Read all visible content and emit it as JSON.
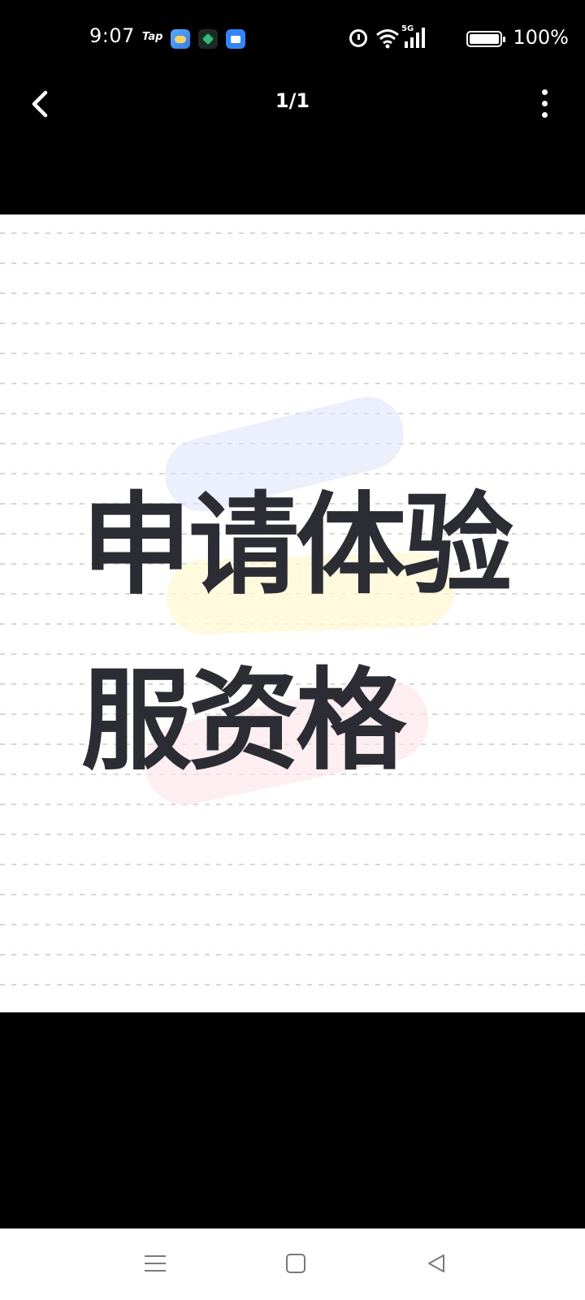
{
  "status_bar": {
    "time": "9:07",
    "notification_label": "Tap",
    "network_label": "5G",
    "battery_percent": "100%",
    "battery_level": 1.0
  },
  "app_bar": {
    "page_indicator": "1/1"
  },
  "image": {
    "line1": "申请体验",
    "line2": "服资格"
  },
  "icons": {
    "back": "chevron-left-icon",
    "more": "more-vertical-icon",
    "alarm": "alarm-icon",
    "wifi": "wifi-icon",
    "signal": "signal-icon",
    "battery": "battery-icon",
    "nav_menu": "menu-icon",
    "nav_home": "home-square-icon",
    "nav_back": "back-triangle-icon"
  },
  "colors": {
    "headline": "#2c2c35",
    "background": "#000000",
    "image_background": "#ffffff"
  }
}
